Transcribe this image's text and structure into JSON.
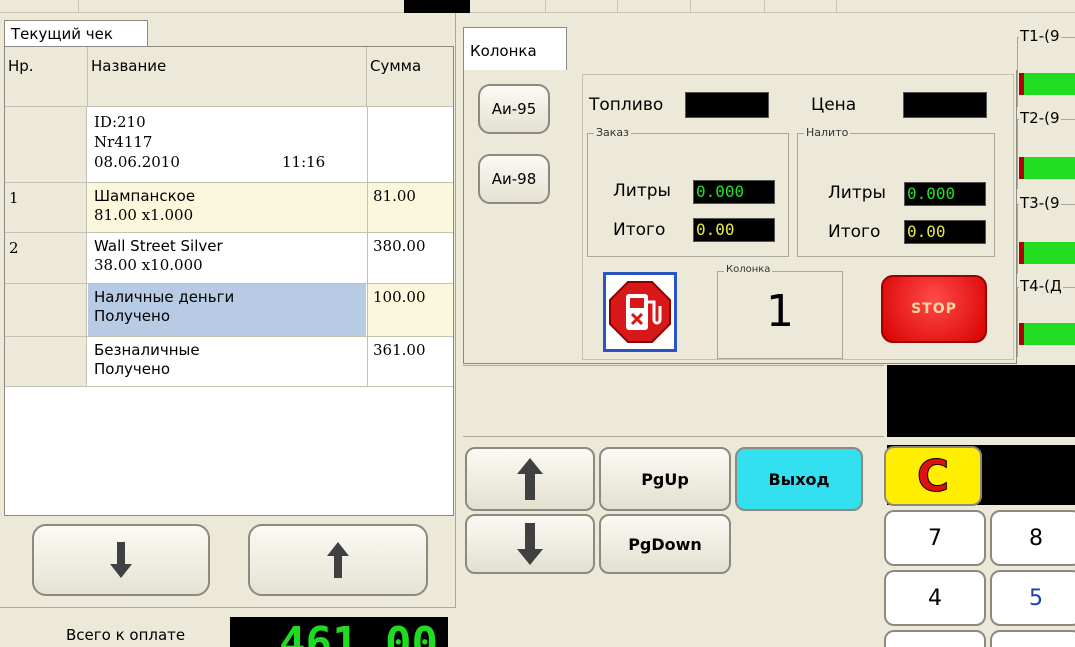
{
  "receipt": {
    "tab_label": "Текущий чек",
    "columns": {
      "number": "Нр.",
      "name": "Название",
      "sum": "Сумма"
    },
    "header_block": {
      "id": "ID:210",
      "nr": "Nr4117",
      "date": "08.06.2010",
      "time": "11:16"
    },
    "rows": [
      {
        "num": "1",
        "name": "Шампанское",
        "detail": "81.00 x1.000",
        "sum": "81.00"
      },
      {
        "num": "2",
        "name": "Wall Street Silver",
        "detail": "38.00 x10.000",
        "sum": "380.00"
      },
      {
        "num": "",
        "name": "Наличные деньги",
        "detail": "Получено",
        "sum": "100.00"
      },
      {
        "num": "",
        "name": "Безналичные",
        "detail": "Получено",
        "sum": "361.00"
      }
    ],
    "total_label": "Всего к оплате",
    "total_value": "461.00"
  },
  "pump": {
    "tab_label": "Колонка",
    "fuel_buttons": [
      "Аи-95",
      "Аи-98"
    ],
    "fuel_label": "Топливо",
    "price_label": "Цена",
    "order_caption": "Заказ",
    "poured_caption": "Налито",
    "liters_label": "Литры",
    "total_label": "Итого",
    "order_liters": "0.000",
    "order_total": "0.00",
    "poured_liters": "0.000",
    "poured_total": "0.00",
    "pump_caption": "Колонка",
    "pump_number": "1",
    "stop_label": "STOP"
  },
  "tanks": [
    {
      "label": "T1-(9"
    },
    {
      "label": "T2-(9"
    },
    {
      "label": "T3-(9"
    },
    {
      "label": "T4-(Д"
    }
  ],
  "nav": {
    "pgup_label": "PgUp",
    "pgdown_label": "PgDown",
    "exit_label": "Выход"
  },
  "keypad": {
    "clear_label": "C",
    "keys": [
      "7",
      "8",
      "4",
      "5"
    ]
  },
  "colors": {
    "lcd_green": "#22e022",
    "lcd_yellow": "#e8e84a",
    "stop_red": "#ee1111",
    "exit_cyan": "#33e0f0",
    "clear_yellow": "#ffee00",
    "clear_red": "#e01010",
    "payment_row_blue": "#b8cbe4",
    "item_row_cream": "#fbf7dc"
  }
}
